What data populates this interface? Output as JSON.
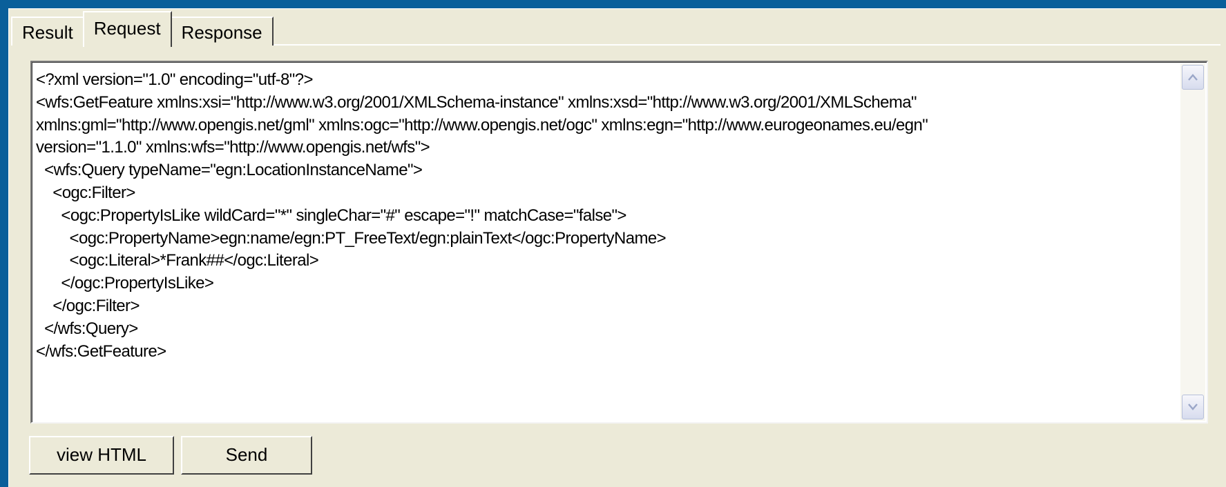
{
  "tabs": [
    {
      "label": "Result",
      "active": false
    },
    {
      "label": "Request",
      "active": true
    },
    {
      "label": "Response",
      "active": false
    }
  ],
  "editor": {
    "text": "<?xml version=\"1.0\" encoding=\"utf-8\"?>\n<wfs:GetFeature xmlns:xsi=\"http://www.w3.org/2001/XMLSchema-instance\" xmlns:xsd=\"http://www.w3.org/2001/XMLSchema\"\nxmlns:gml=\"http://www.opengis.net/gml\" xmlns:ogc=\"http://www.opengis.net/ogc\" xmlns:egn=\"http://www.eurogeonames.eu/egn\"\nversion=\"1.1.0\" xmlns:wfs=\"http://www.opengis.net/wfs\">\n  <wfs:Query typeName=\"egn:LocationInstanceName\">\n    <ogc:Filter>\n      <ogc:PropertyIsLike wildCard=\"*\" singleChar=\"#\" escape=\"!\" matchCase=\"false\">\n        <ogc:PropertyName>egn:name/egn:PT_FreeText/egn:plainText</ogc:PropertyName>\n        <ogc:Literal>*Frank##</ogc:Literal>\n      </ogc:PropertyIsLike>\n    </ogc:Filter>\n  </wfs:Query>\n</wfs:GetFeature>"
  },
  "buttons": {
    "view_html": "view HTML",
    "send": "Send"
  },
  "icons": {
    "scroll_up": "scroll-up-arrow",
    "scroll_down": "scroll-down-arrow"
  },
  "colors": {
    "frame": "#0a5f9a",
    "panel": "#ecead8",
    "editor_bg": "#ffffff"
  }
}
